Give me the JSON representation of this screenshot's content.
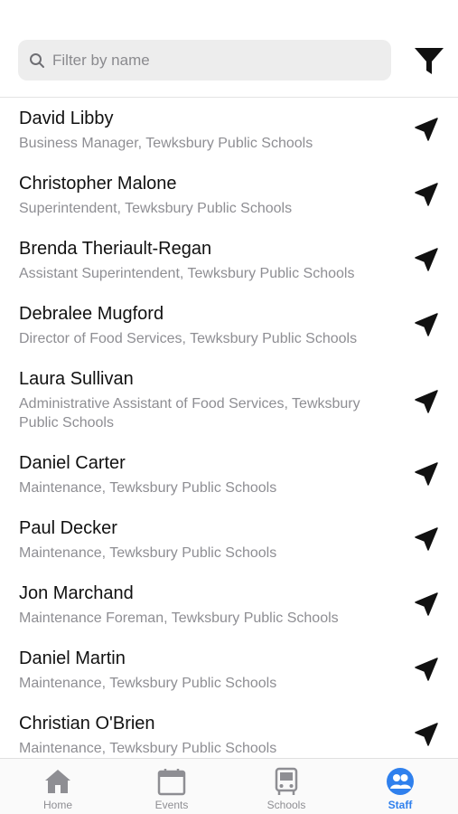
{
  "search": {
    "placeholder": "Filter by name",
    "value": ""
  },
  "staff": [
    {
      "name": "David Libby",
      "title": "Business Manager, Tewksbury Public Schools"
    },
    {
      "name": "Christopher Malone",
      "title": "Superintendent, Tewksbury Public Schools"
    },
    {
      "name": "Brenda Theriault-Regan",
      "title": "Assistant Superintendent, Tewksbury Public Schools"
    },
    {
      "name": "Debralee Mugford",
      "title": "Director of Food Services, Tewksbury Public Schools"
    },
    {
      "name": "Laura Sullivan",
      "title": "Administrative Assistant of Food Services, Tewksbury Public Schools"
    },
    {
      "name": "Daniel Carter",
      "title": "Maintenance, Tewksbury Public Schools"
    },
    {
      "name": "Paul Decker",
      "title": "Maintenance, Tewksbury Public Schools"
    },
    {
      "name": "Jon Marchand",
      "title": "Maintenance Foreman, Tewksbury Public Schools"
    },
    {
      "name": "Daniel Martin",
      "title": "Maintenance, Tewksbury Public Schools"
    },
    {
      "name": "Christian O'Brien",
      "title": "Maintenance, Tewksbury Public Schools"
    }
  ],
  "tabs": [
    {
      "label": "Home",
      "icon": "home-icon",
      "active": false
    },
    {
      "label": "Events",
      "icon": "calendar-icon",
      "active": false
    },
    {
      "label": "Schools",
      "icon": "bus-icon",
      "active": false
    },
    {
      "label": "Staff",
      "icon": "staff-icon",
      "active": true
    }
  ],
  "colors": {
    "accent": "#2f80ed",
    "inactive": "#8e8e93",
    "search_bg": "#ededed",
    "text_secondary": "#8e8e93"
  }
}
